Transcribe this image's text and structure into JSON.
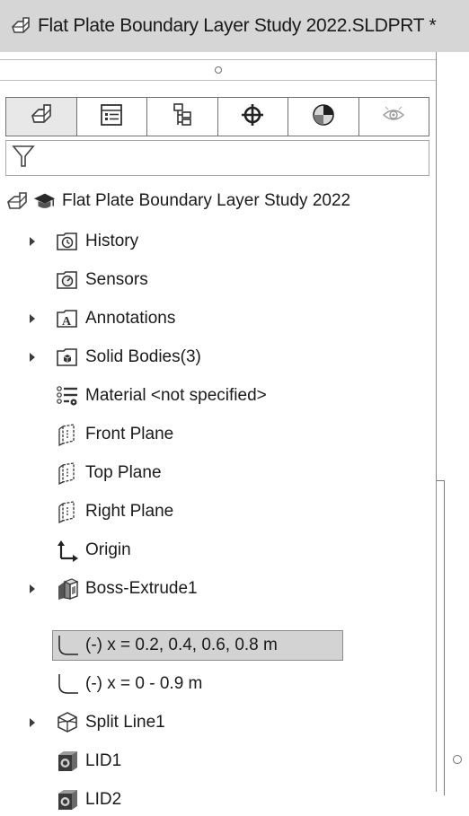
{
  "window": {
    "title": "Flat Plate Boundary Layer Study 2022.SLDPRT *"
  },
  "tabs": [
    {
      "icon": "part-icon",
      "active": true
    },
    {
      "icon": "property-manager-icon",
      "active": false
    },
    {
      "icon": "configuration-manager-icon",
      "active": false
    },
    {
      "icon": "dimxpert-icon",
      "active": false
    },
    {
      "icon": "display-manager-icon",
      "active": false
    },
    {
      "icon": "visibility-icon",
      "active": false
    }
  ],
  "filter": {
    "icon": "funnel-icon"
  },
  "tree": {
    "root": {
      "label": "Flat Plate Boundary Layer Study 2022",
      "icons": [
        "part-icon",
        "graduation-cap-icon"
      ]
    },
    "items": [
      {
        "label": "History",
        "icon": "history-folder-icon",
        "expandable": true
      },
      {
        "label": "Sensors",
        "icon": "sensors-folder-icon",
        "expandable": false
      },
      {
        "label": "Annotations",
        "icon": "annotations-folder-icon",
        "expandable": true
      },
      {
        "label": "Solid Bodies(3)",
        "icon": "solid-bodies-folder-icon",
        "expandable": true
      },
      {
        "label": "Material <not specified>",
        "icon": "material-icon",
        "expandable": false
      },
      {
        "label": "Front Plane",
        "icon": "plane-icon",
        "expandable": false
      },
      {
        "label": "Top Plane",
        "icon": "plane-icon",
        "expandable": false
      },
      {
        "label": "Right Plane",
        "icon": "plane-icon",
        "expandable": false
      },
      {
        "label": "Origin",
        "icon": "origin-icon",
        "expandable": false
      },
      {
        "label": "Boss-Extrude1",
        "icon": "boss-extrude-icon",
        "expandable": true
      },
      {
        "label": "(-) x = 0.2, 0.4, 0.6, 0.8 m",
        "icon": "sketch-icon",
        "expandable": false,
        "selected": true
      },
      {
        "label": "(-) x = 0 - 0.9 m",
        "icon": "sketch-icon",
        "expandable": false
      },
      {
        "label": "Split Line1",
        "icon": "split-line-icon",
        "expandable": true
      },
      {
        "label": "LID1",
        "icon": "lid-icon",
        "expandable": false
      },
      {
        "label": "LID2",
        "icon": "lid-icon",
        "expandable": false
      }
    ]
  }
}
